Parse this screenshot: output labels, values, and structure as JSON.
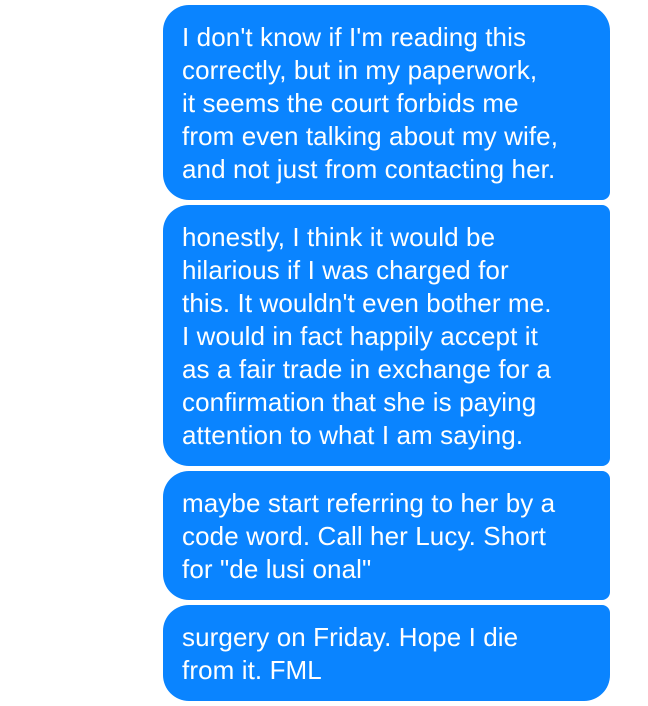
{
  "conversation": {
    "theme": {
      "sent_bubble_color": "#0a84ff",
      "sent_text_color": "#ffffff",
      "background_color": "#ffffff"
    },
    "messages": [
      {
        "direction": "sent",
        "text": "I don't know if I'm reading this\ncorrectly, but in my paperwork,\nit seems the court forbids me\nfrom even talking about my wife,\nand not just from contacting her."
      },
      {
        "direction": "sent",
        "text": "honestly, I think it would be\nhilarious if I was charged for\nthis. It wouldn't even bother me.\nI would in fact happily accept it\nas a fair trade in exchange for a\nconfirmation that she is paying\nattention to what I am saying."
      },
      {
        "direction": "sent",
        "text": "maybe start referring to her by a\ncode word. Call her Lucy. Short\nfor \"de lusi onal\""
      },
      {
        "direction": "sent",
        "text": "surgery on Friday. Hope I die\nfrom it. FML"
      }
    ]
  }
}
